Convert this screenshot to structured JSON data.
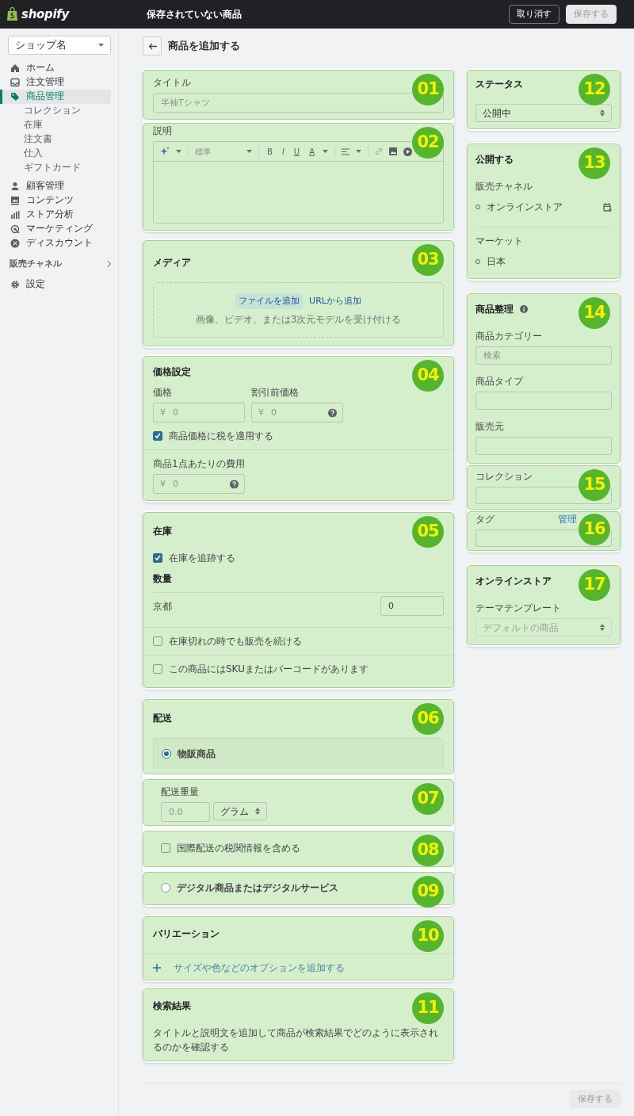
{
  "topbar": {
    "logo": "shopify",
    "title": "保存されていない商品",
    "buttons": [
      {
        "label": "取り消す",
        "kind": "outline",
        "disabled": false
      },
      {
        "label": "保存する",
        "kind": "light",
        "disabled": true
      }
    ]
  },
  "sidebar": {
    "store": "ショップ名",
    "items": [
      {
        "label": "ホーム",
        "selected": false
      },
      {
        "label": "注文管理",
        "selected": false
      },
      {
        "label": "商品管理",
        "selected": true,
        "children": [
          {
            "label": "コレクション",
            "selected": false
          },
          {
            "label": "在庫",
            "selected": false
          },
          {
            "label": "注文書",
            "selected": false
          },
          {
            "label": "仕入",
            "selected": false
          },
          {
            "label": "ギフトカード",
            "selected": false
          }
        ]
      },
      {
        "label": "顧客管理",
        "selected": false
      },
      {
        "label": "コンテンツ",
        "selected": false
      },
      {
        "label": "ストア分析",
        "selected": false
      },
      {
        "label": "マーケティング",
        "selected": false
      },
      {
        "label": "ディスカウント",
        "selected": false
      }
    ],
    "channels_label": "販売チャネル",
    "settings": {
      "label": "設定",
      "selected": false
    }
  },
  "page": {
    "title": "商品を追加する"
  },
  "main": {
    "title_field": {
      "badge": "01",
      "label": "タイトル",
      "placeholder": "半袖Tシャツ"
    },
    "description": {
      "badge": "02",
      "label": "説明",
      "format": "標準",
      "format_buttons": [
        "B",
        "I",
        "U",
        "A"
      ]
    },
    "media": {
      "badge": "03",
      "heading": "メディア",
      "add_file": "ファイルを追加",
      "add_url": "URLから追加",
      "hint": "画像、ビデオ、または3次元モデルを受け付ける"
    },
    "pricing": {
      "badge": "04",
      "heading": "価格設定",
      "price": {
        "label": "価格",
        "currency": "¥",
        "placeholder": "0"
      },
      "compare": {
        "label": "割引前価格",
        "currency": "¥",
        "placeholder": "0"
      },
      "tax": {
        "label": "商品価格に税を適用する",
        "checked": true
      },
      "cost": {
        "label": "商品1点あたりの費用",
        "currency": "¥",
        "placeholder": "0"
      }
    },
    "inventory": {
      "badge": "05",
      "heading": "在庫",
      "track": {
        "label": "在庫を追跡する",
        "checked": true
      },
      "quantity_heading": "数量",
      "locations": [
        {
          "name": "京都",
          "value": "0"
        }
      ],
      "options": [
        {
          "label": "在庫切れの時でも販売を続ける",
          "checked": false
        },
        {
          "label": "この商品にはSKUまたはバーコードがあります",
          "checked": false
        }
      ]
    },
    "shipping": {
      "badge": "06",
      "heading": "配送",
      "physical": {
        "label": "物販商品",
        "selected": true
      },
      "weight": {
        "badge": "07",
        "label": "配送重量",
        "placeholder": "0.0",
        "unit": "グラム"
      },
      "customs": {
        "badge": "08",
        "label": "国際配送の税関情報を含める",
        "checked": false
      },
      "digital": {
        "badge": "09",
        "label": "デジタル商品またはデジタルサービス",
        "selected": false
      }
    },
    "variants": {
      "badge": "10",
      "heading": "バリエーション",
      "add": "サイズや色などのオプションを追加する"
    },
    "seo": {
      "badge": "11",
      "heading": "検索結果",
      "text": "タイトルと説明文を追加して商品が検索結果でどのように表示されるのかを確認する"
    }
  },
  "side": {
    "status": {
      "badge": "12",
      "heading": "ステータス",
      "value": "公開中"
    },
    "publishing": {
      "badge": "13",
      "heading": "公開する",
      "channels_label": "販売チャネル",
      "channels": [
        "オンラインストア"
      ],
      "markets_label": "マーケット",
      "markets": [
        "日本"
      ]
    },
    "organization": {
      "badge": "14",
      "heading": "商品整理",
      "fields": [
        {
          "label": "商品カテゴリー",
          "placeholder": "検索"
        },
        {
          "label": "商品タイプ"
        },
        {
          "label": "販売元"
        }
      ],
      "collections": {
        "badge": "15",
        "label": "コレクション"
      },
      "tags": {
        "badge": "16",
        "label": "タグ",
        "link": "管理"
      }
    },
    "online_store": {
      "badge": "17",
      "heading": "オンラインストア",
      "template_label": "テーマテンプレート",
      "template": "デフォルトの商品",
      "disabled": true
    }
  },
  "footer": {
    "save": "保存する",
    "disabled": true
  }
}
